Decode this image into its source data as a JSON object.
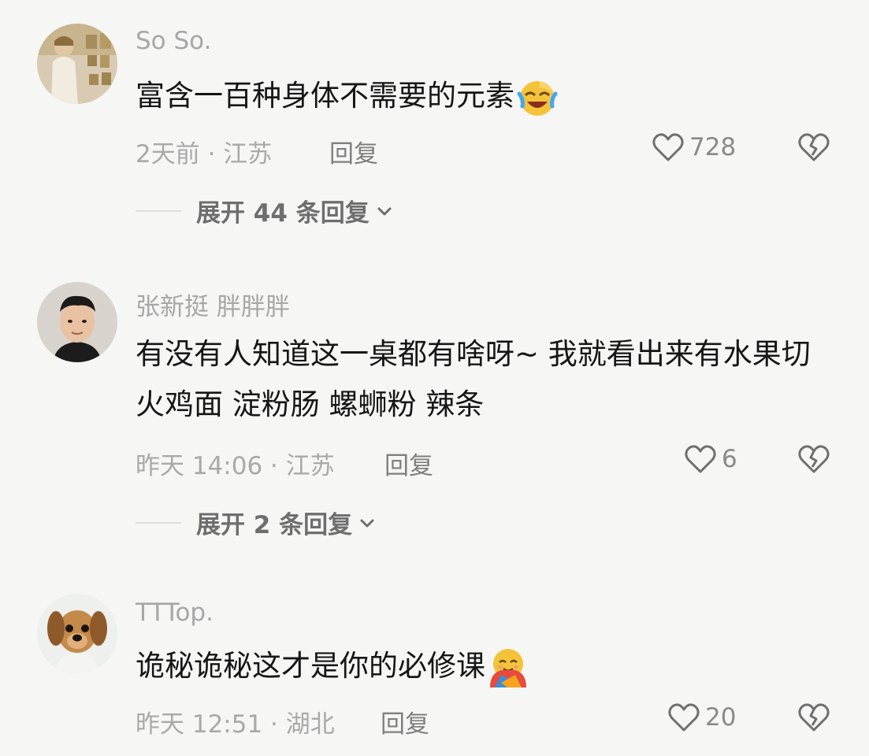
{
  "comments": [
    {
      "avatar": "avatar-person-with-bread-shelves",
      "username": "So So.",
      "text": "富含一百种身体不需要的元素",
      "emoji": "laughing-crying-emoji",
      "time_location": "2天前 · 江苏",
      "reply_label": "回复",
      "likes": "728",
      "expand_label": "展开 44 条回复"
    },
    {
      "avatar": "avatar-man-with-dark-hair",
      "username": "张新挺 胖胖胖",
      "text": "有没有人知道这一桌都有啥呀~ 我就看出来有水果切  火鸡面 淀粉肠 螺蛳粉 辣条",
      "time_location": "昨天 14:06 · 江苏",
      "reply_label": "回复",
      "likes": "6",
      "expand_label": "展开 2 条回复"
    },
    {
      "avatar": "avatar-puppy",
      "username": "TTTop.",
      "text": "诡秘诡秘这才是你的必修课",
      "emoji": "hugging-smiling-emoji",
      "time_location": "昨天 12:51 · 湖北",
      "reply_label": "回复",
      "likes": "20"
    }
  ],
  "colors": {
    "background": "#f6f6f4",
    "username": "#a7a7a7",
    "text": "#161616",
    "meta": "#a9a9a9",
    "icon": "#6f6f6f"
  }
}
